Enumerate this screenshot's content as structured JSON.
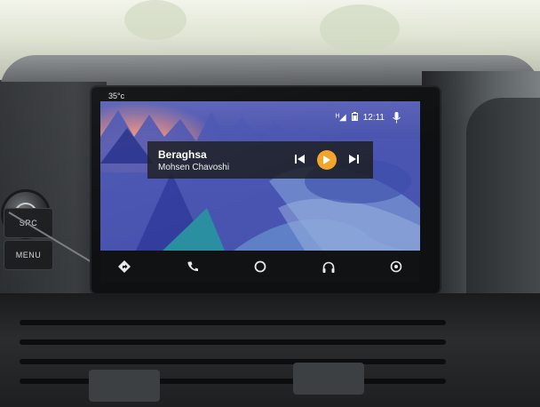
{
  "car_panel": {
    "src_label": "SRC",
    "menu_label": "MENU"
  },
  "screen": {
    "temperature": "35°c",
    "status": {
      "network_indicator": "ᴴ◢",
      "battery_icon": "battery-icon",
      "time": "12:11"
    },
    "mic_icon": "mic-icon",
    "now_playing": {
      "track": "Beraghsa",
      "artist": "Mohsen Chavoshi",
      "controls": [
        "previous",
        "play",
        "next"
      ]
    },
    "nav_bar": [
      {
        "name": "navigation-icon"
      },
      {
        "name": "phone-icon"
      },
      {
        "name": "home-icon"
      },
      {
        "name": "headphones-icon"
      },
      {
        "name": "car-exit-icon"
      }
    ]
  },
  "colors": {
    "play_accent": "#f3a42a",
    "screen_bg": "#3f4aa6"
  }
}
